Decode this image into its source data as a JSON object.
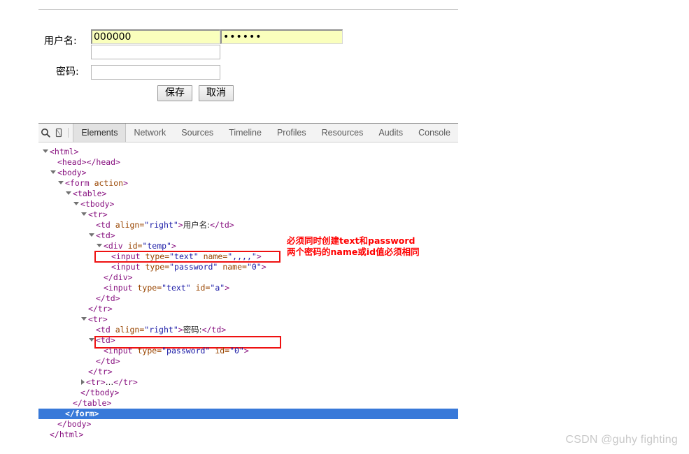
{
  "page": {
    "watermark": "CSDN @guhy fighting"
  },
  "form": {
    "username_label": "用户名:",
    "password_label": "密码:",
    "username_value": "000000",
    "username_blank_value": "",
    "password_value": "",
    "password_mirror_value": "••••••",
    "save_button": "保存",
    "cancel_button": "取消"
  },
  "devtools": {
    "tools": [
      {
        "name": "inspect-element-icon",
        "glyph": "search-icon"
      },
      {
        "name": "device-mode-icon",
        "glyph": "phone-icon"
      }
    ],
    "tabs": [
      {
        "label": "Elements",
        "active": true
      },
      {
        "label": "Network",
        "active": false
      },
      {
        "label": "Sources",
        "active": false
      },
      {
        "label": "Timeline",
        "active": false
      },
      {
        "label": "Profiles",
        "active": false
      },
      {
        "label": "Resources",
        "active": false
      },
      {
        "label": "Audits",
        "active": false
      },
      {
        "label": "Console",
        "active": false
      }
    ],
    "selection_color": "#3879d9",
    "tree": [
      {
        "indent": 0,
        "arrow": "down",
        "text": "<html>"
      },
      {
        "indent": 1,
        "arrow": "none",
        "text": "<head></head>"
      },
      {
        "indent": 1,
        "arrow": "down",
        "text": "<body>"
      },
      {
        "indent": 2,
        "arrow": "down",
        "text": "<form action>"
      },
      {
        "indent": 3,
        "arrow": "down",
        "text": "<table>"
      },
      {
        "indent": 4,
        "arrow": "down",
        "text": "<tbody>"
      },
      {
        "indent": 5,
        "arrow": "down",
        "text": "<tr>"
      },
      {
        "indent": 6,
        "arrow": "none",
        "text": "<td align=\"right\">用户名:</td>"
      },
      {
        "indent": 6,
        "arrow": "down",
        "text": "<td>"
      },
      {
        "indent": 7,
        "arrow": "down",
        "text": "<div id=\"temp\">"
      },
      {
        "indent": 8,
        "arrow": "none",
        "text": "<input type=\"text\" name=\",,,,\">"
      },
      {
        "indent": 8,
        "arrow": "none",
        "text": "<input type=\"password\" name=\"0\">"
      },
      {
        "indent": 7,
        "arrow": "none",
        "text": "</div>"
      },
      {
        "indent": 7,
        "arrow": "none",
        "text": "<input type=\"text\" id=\"a\">"
      },
      {
        "indent": 6,
        "arrow": "none",
        "text": "</td>"
      },
      {
        "indent": 5,
        "arrow": "none",
        "text": "</tr>"
      },
      {
        "indent": 5,
        "arrow": "down",
        "text": "<tr>"
      },
      {
        "indent": 6,
        "arrow": "none",
        "text": "<td align=\"right\">密码:</td>"
      },
      {
        "indent": 6,
        "arrow": "down",
        "text": "<td>"
      },
      {
        "indent": 7,
        "arrow": "none",
        "text": "<input type=\"password\" id=\"0\">"
      },
      {
        "indent": 6,
        "arrow": "none",
        "text": "</td>"
      },
      {
        "indent": 5,
        "arrow": "none",
        "text": "</tr>"
      },
      {
        "indent": 5,
        "arrow": "right",
        "text": "<tr>…</tr>"
      },
      {
        "indent": 4,
        "arrow": "none",
        "text": "</tbody>"
      },
      {
        "indent": 3,
        "arrow": "none",
        "text": "</table>"
      },
      {
        "indent": 2,
        "arrow": "none",
        "text": "</form>",
        "selected": true
      },
      {
        "indent": 1,
        "arrow": "none",
        "text": "</body>"
      },
      {
        "indent": 0,
        "arrow": "none",
        "text": "</html>"
      }
    ]
  },
  "annotations": {
    "color": "#ff0000",
    "note_line1": "必须同时创建text和password",
    "note_line2": "两个密码的name或id值必须相同",
    "highlight_1": "<input type=\"password\" name=\"0\">",
    "highlight_2": "<input type=\"password\" id=\"0\">"
  }
}
